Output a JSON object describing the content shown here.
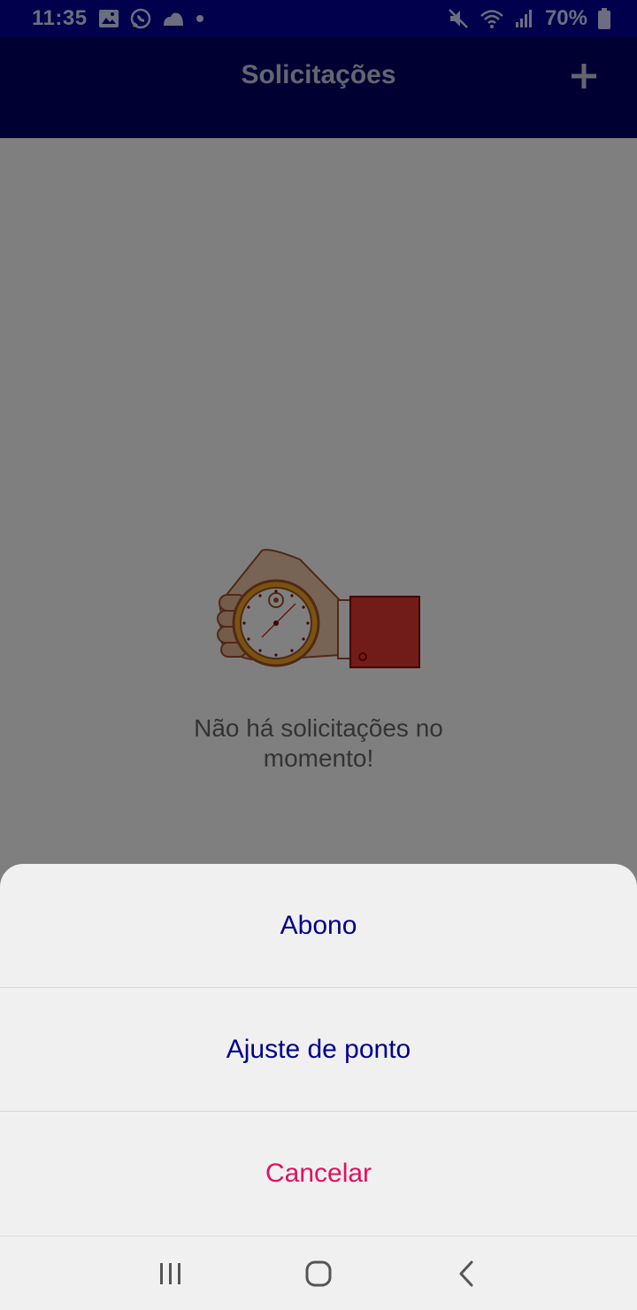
{
  "status_bar": {
    "time": "11:35",
    "battery": "70%",
    "icons": [
      "image-icon",
      "whatsapp-icon",
      "cloud-icon",
      "dot-icon",
      "mute-icon",
      "wifi-icon",
      "signal-icon",
      "battery-icon"
    ]
  },
  "app_bar": {
    "title": "Solicitações",
    "add_icon": "plus-icon"
  },
  "empty_state": {
    "message": "Não há solicitações no momento!",
    "illustration": "hand-stopwatch-illustration"
  },
  "action_sheet": {
    "options": [
      {
        "label": "Abono"
      },
      {
        "label": "Ajuste de ponto"
      }
    ],
    "cancel_label": "Cancelar"
  },
  "nav_bar": {
    "icons": [
      "recent-apps-icon",
      "home-icon",
      "back-icon"
    ]
  },
  "colors": {
    "status_bar": "#000099",
    "app_bar": "#000066",
    "option_text": "#00008b",
    "cancel_text": "#e0115f",
    "sheet_bg": "#f0f0f0"
  }
}
